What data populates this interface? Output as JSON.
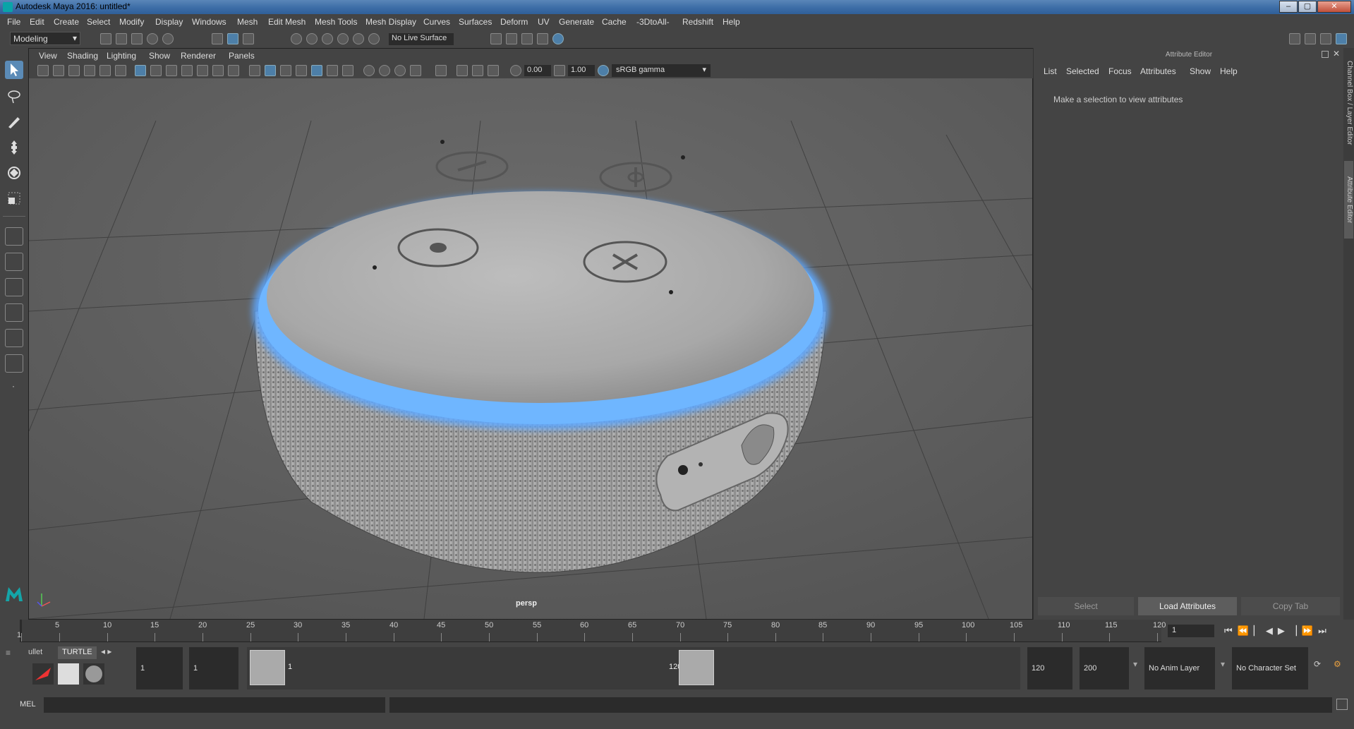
{
  "window": {
    "title": "Autodesk Maya 2016: untitled*",
    "min_icon": "–",
    "max_icon": "▢",
    "close_icon": "✕"
  },
  "menu": [
    "File",
    "Edit",
    "Create",
    "Select",
    "Modify",
    "Display",
    "Windows",
    "Mesh",
    "Edit Mesh",
    "Mesh Tools",
    "Mesh Display",
    "Curves",
    "Surfaces",
    "Deform",
    "UV",
    "Generate",
    "Cache",
    "-3DtoAll-",
    "Redshift",
    "Help"
  ],
  "shelf": {
    "mode": "Modeling",
    "live_surface": "No Live Surface"
  },
  "viewport": {
    "menu": [
      "View",
      "Shading",
      "Lighting",
      "Show",
      "Renderer",
      "Panels"
    ],
    "exposure": "0.00",
    "gamma": "1.00",
    "color_space": "sRGB gamma",
    "camera_label": "persp"
  },
  "attribute_editor": {
    "header": "Attribute Editor",
    "tabs": [
      "List",
      "Selected",
      "Focus",
      "Attributes",
      "Show",
      "Help"
    ],
    "message": "Make a selection to view attributes",
    "buttons": [
      "Select",
      "Load Attributes",
      "Copy Tab"
    ],
    "side_tabs": [
      "Channel Box / Layer Editor",
      "Attribute Editor"
    ]
  },
  "timeline": {
    "ticks": [
      "1",
      "5",
      "10",
      "15",
      "20",
      "25",
      "30",
      "35",
      "40",
      "45",
      "50",
      "55",
      "60",
      "65",
      "70",
      "75",
      "80",
      "85",
      "90",
      "95",
      "100",
      "105",
      "110",
      "115",
      "120"
    ],
    "current_frame": "1"
  },
  "shelf_tabs": {
    "tab1": "ullet",
    "tab2": "TURTLE"
  },
  "range": {
    "start": "1",
    "playback_start": "1",
    "slider_start": "1",
    "slider_end": "120",
    "playback_end": "120",
    "end": "200",
    "anim_layer": "No Anim Layer",
    "character_set": "No Character Set"
  },
  "command_line": {
    "label": "MEL"
  },
  "colors": {
    "accent_blue": "#5b8bb7",
    "ring_glow": "#5fa8ff",
    "panel": "#444444"
  }
}
